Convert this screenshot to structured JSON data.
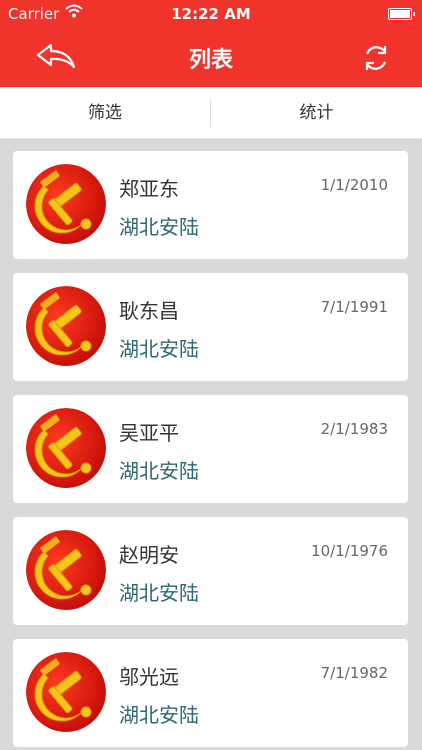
{
  "status_bar": {
    "carrier": "Carrier",
    "time": "12:22 AM",
    "battery_level": 1.0
  },
  "nav": {
    "title": "列表",
    "back_icon": "back-arrow-icon",
    "refresh_icon": "refresh-icon"
  },
  "tabs": [
    {
      "label": "筛选"
    },
    {
      "label": "统计"
    }
  ],
  "colors": {
    "header": "#f0332b",
    "location_text": "#2c6870",
    "background": "#d9d9d9"
  },
  "items": [
    {
      "name": "郑亚东",
      "date": "1/1/2010",
      "location": "湖北安陆",
      "avatar_icon": "party-emblem-icon"
    },
    {
      "name": "耿东昌",
      "date": "7/1/1991",
      "location": "湖北安陆",
      "avatar_icon": "party-emblem-icon"
    },
    {
      "name": "吴亚平",
      "date": "2/1/1983",
      "location": "湖北安陆",
      "avatar_icon": "party-emblem-icon"
    },
    {
      "name": "赵明安",
      "date": "10/1/1976",
      "location": "湖北安陆",
      "avatar_icon": "party-emblem-icon"
    },
    {
      "name": "邬光远",
      "date": "7/1/1982",
      "location": "湖北安陆",
      "avatar_icon": "party-emblem-icon"
    }
  ]
}
